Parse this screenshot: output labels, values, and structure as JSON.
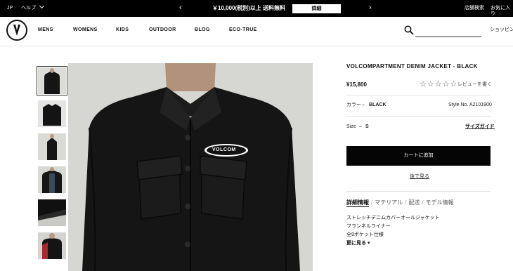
{
  "topbar": {
    "region": "JP",
    "help": "ヘルプ",
    "promo_prev": "‹",
    "promo_text": "￥10,000(税別)以上 送料無料",
    "promo_detail": "詳細",
    "promo_next": "›",
    "store_search": "店舗検索",
    "favorites": "お気に入り"
  },
  "header": {
    "nav": [
      "MENS",
      "WOMENS",
      "KIDS",
      "OUTDOOR",
      "BLOG",
      "ECO-TRUE"
    ],
    "search_placeholder": "",
    "shopping": "ショッピング"
  },
  "product": {
    "title": "VOLCOMPARTMENT DENIM JACKET - BLACK",
    "price": "¥15,800",
    "stars": "☆☆☆☆☆",
    "review_link": "レビューを書く",
    "color_label": "カラー",
    "color_dash": "–",
    "color_value": "BLACK",
    "style_no": "Style No. A2101900",
    "size_label": "Size",
    "size_dash": "–",
    "size_value": "S",
    "size_guide": "サイズガイド",
    "add_to_cart": "カートに追加",
    "save_later": "後で見る",
    "tabs": [
      "詳細情報",
      "マテリアル",
      "配送",
      "モデル情報"
    ],
    "description": [
      "ストレッチデニムカバーオールジャケット",
      "フランネルライナー",
      "全9ポケット仕様"
    ],
    "more": "更に見る ▾",
    "chest_logo": "VOLCOM"
  },
  "colors": {
    "accent": "#000000",
    "brand_green": "#2e7d3a"
  }
}
